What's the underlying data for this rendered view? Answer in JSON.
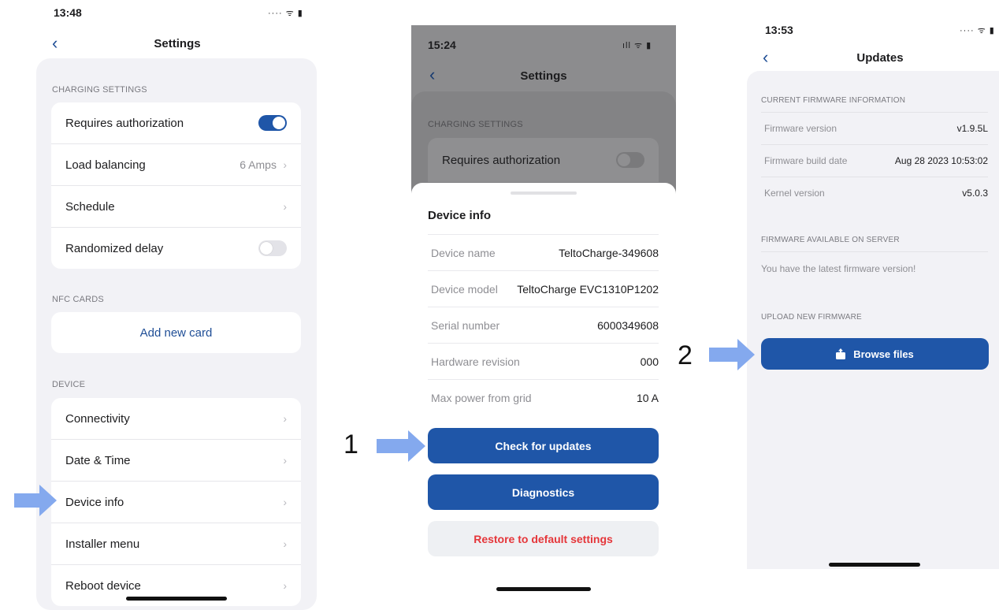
{
  "screen1": {
    "time": "13:48",
    "status": "····  ᯤ ▮",
    "title": "Settings",
    "charging_label": "CHARGING SETTINGS",
    "charging_items": [
      {
        "label": "Requires authorization",
        "toggle": "on"
      },
      {
        "label": "Load balancing",
        "value": "6 Amps"
      },
      {
        "label": "Schedule"
      },
      {
        "label": "Randomized delay",
        "toggle": "off"
      }
    ],
    "nfc_label": "NFC CARDS",
    "add_card": "Add new card",
    "device_label": "DEVICE",
    "device_items": [
      "Connectivity",
      "Date & Time",
      "Device info",
      "Installer menu",
      "Reboot device"
    ]
  },
  "screen2": {
    "time": "15:24",
    "status": "ıll ᯤ ▮",
    "title": "Settings",
    "charging_label": "CHARGING SETTINGS",
    "requires_auth": "Requires authorization",
    "sheet_title": "Device info",
    "info": [
      {
        "key": "Device name",
        "value": "TeltoCharge-349608"
      },
      {
        "key": "Device model",
        "value": "TeltoCharge EVC1310P1202"
      },
      {
        "key": "Serial number",
        "value": "6000349608"
      },
      {
        "key": "Hardware revision",
        "value": "000"
      },
      {
        "key": "Max power from grid",
        "value": "10 A"
      }
    ],
    "check_updates": "Check for updates",
    "diagnostics": "Diagnostics",
    "restore": "Restore to default settings"
  },
  "screen3": {
    "time": "13:53",
    "status": "····  ᯤ ▮",
    "title": "Updates",
    "current_label": "CURRENT FIRMWARE INFORMATION",
    "firmware": [
      {
        "key": "Firmware version",
        "value": "v1.9.5L"
      },
      {
        "key": "Firmware build date",
        "value": "Aug 28 2023 10:53:02"
      },
      {
        "key": "Kernel version",
        "value": "v5.0.3"
      }
    ],
    "server_label": "FIRMWARE AVAILABLE ON SERVER",
    "server_msg": "You have the latest firmware version!",
    "upload_label": "UPLOAD NEW FIRMWARE",
    "browse": "Browse files"
  },
  "steps": {
    "one": "1",
    "two": "2"
  },
  "colors": {
    "primary": "#1f56a8",
    "arrow": "#84a9ee",
    "danger": "#e5363a",
    "panel": "#f2f2f6"
  },
  "icons": {
    "back": "chevron-left-icon",
    "chevron": "chevron-right-icon",
    "upload": "upload-icon",
    "arrow": "pointer-arrow-icon"
  }
}
